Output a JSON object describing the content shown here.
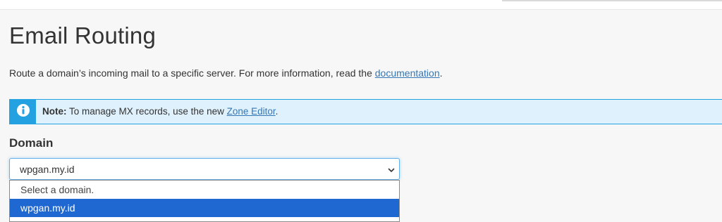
{
  "page": {
    "title": "Email Routing",
    "description_text": "Route a domain’s incoming mail to a specific server. For more information, read the ",
    "description_link": "documentation",
    "description_end": "."
  },
  "callout": {
    "icon": "info-icon",
    "note_label": "Note:",
    "text": " To manage MX records, use the new ",
    "link": "Zone Editor",
    "end": ".",
    "colors": {
      "accent": "#23a1e0",
      "background": "#dff1fc"
    }
  },
  "domain": {
    "label": "Domain",
    "selected_value": "wpgan.my.id",
    "options": [
      "Select a domain.",
      "wpgan.my.id"
    ],
    "highlight_color": "#1f67d1"
  }
}
